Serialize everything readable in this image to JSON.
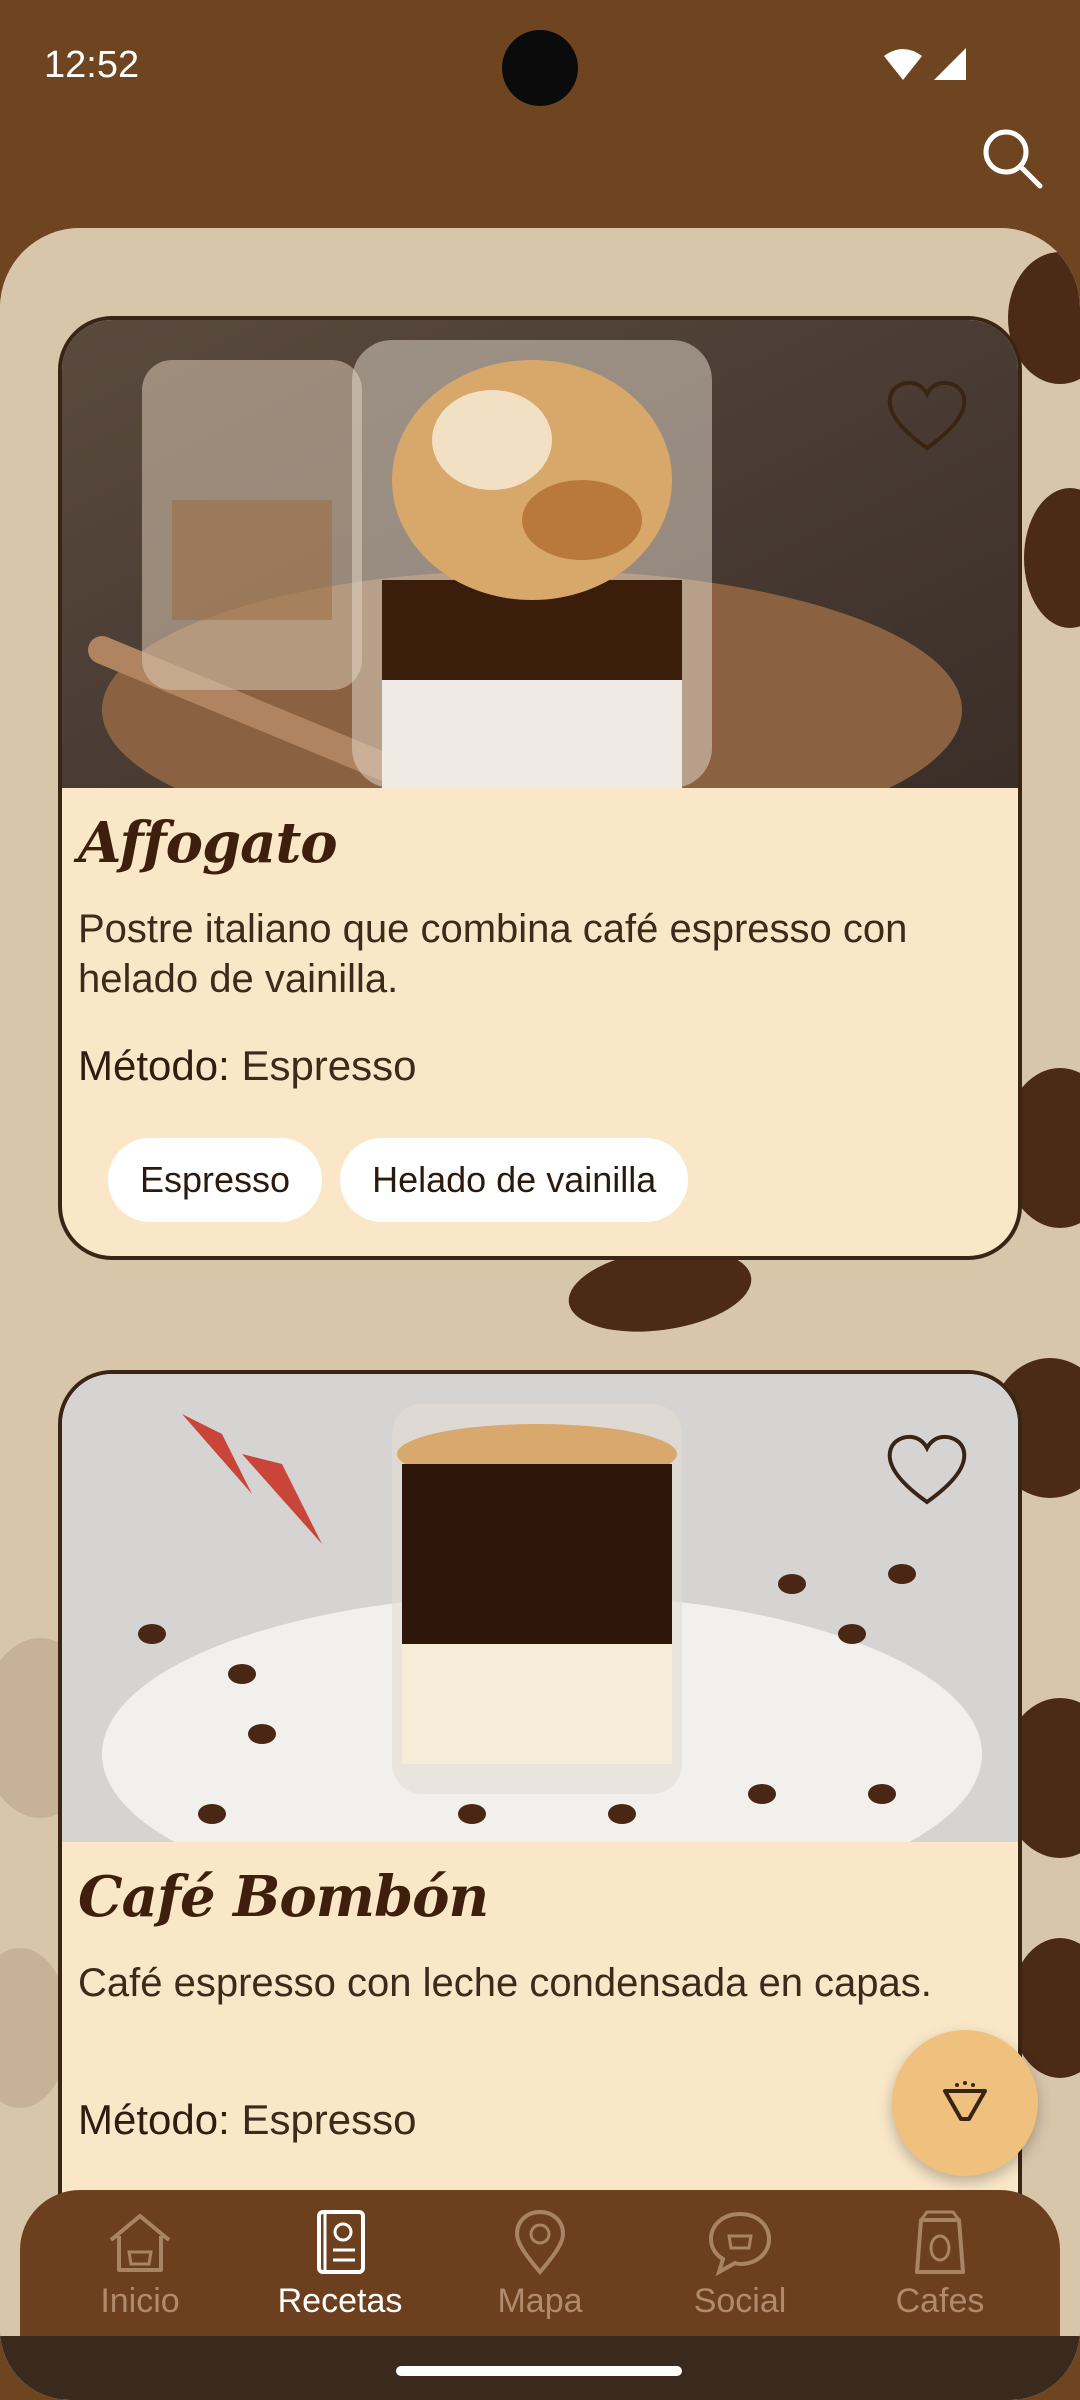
{
  "status_bar": {
    "time": "12:52"
  },
  "recipes": [
    {
      "title": "Affogato",
      "description": "Postre italiano que combina café espresso con helado de vainilla.",
      "method_label": "Método:",
      "method_value": "Espresso",
      "ingredients": [
        "Espresso",
        "Helado de vainilla"
      ]
    },
    {
      "title": "Café Bombón",
      "description": "Café espresso con leche condensada en capas.",
      "method_label": "Método:",
      "method_value": "Espresso",
      "ingredients": []
    }
  ],
  "bottom_nav": {
    "items": [
      {
        "label": "Inicio",
        "icon": "house-icon"
      },
      {
        "label": "Recetas",
        "icon": "recipe-book-icon",
        "active": true
      },
      {
        "label": "Mapa",
        "icon": "map-pin-icon"
      },
      {
        "label": "Social",
        "icon": "chat-bubble-icon"
      },
      {
        "label": "Cafes",
        "icon": "coffee-bag-icon"
      }
    ]
  },
  "colors": {
    "header": "#6f4420",
    "card": "#f9e7c8",
    "fab": "#f0c07e",
    "nav": "#6c401f"
  }
}
